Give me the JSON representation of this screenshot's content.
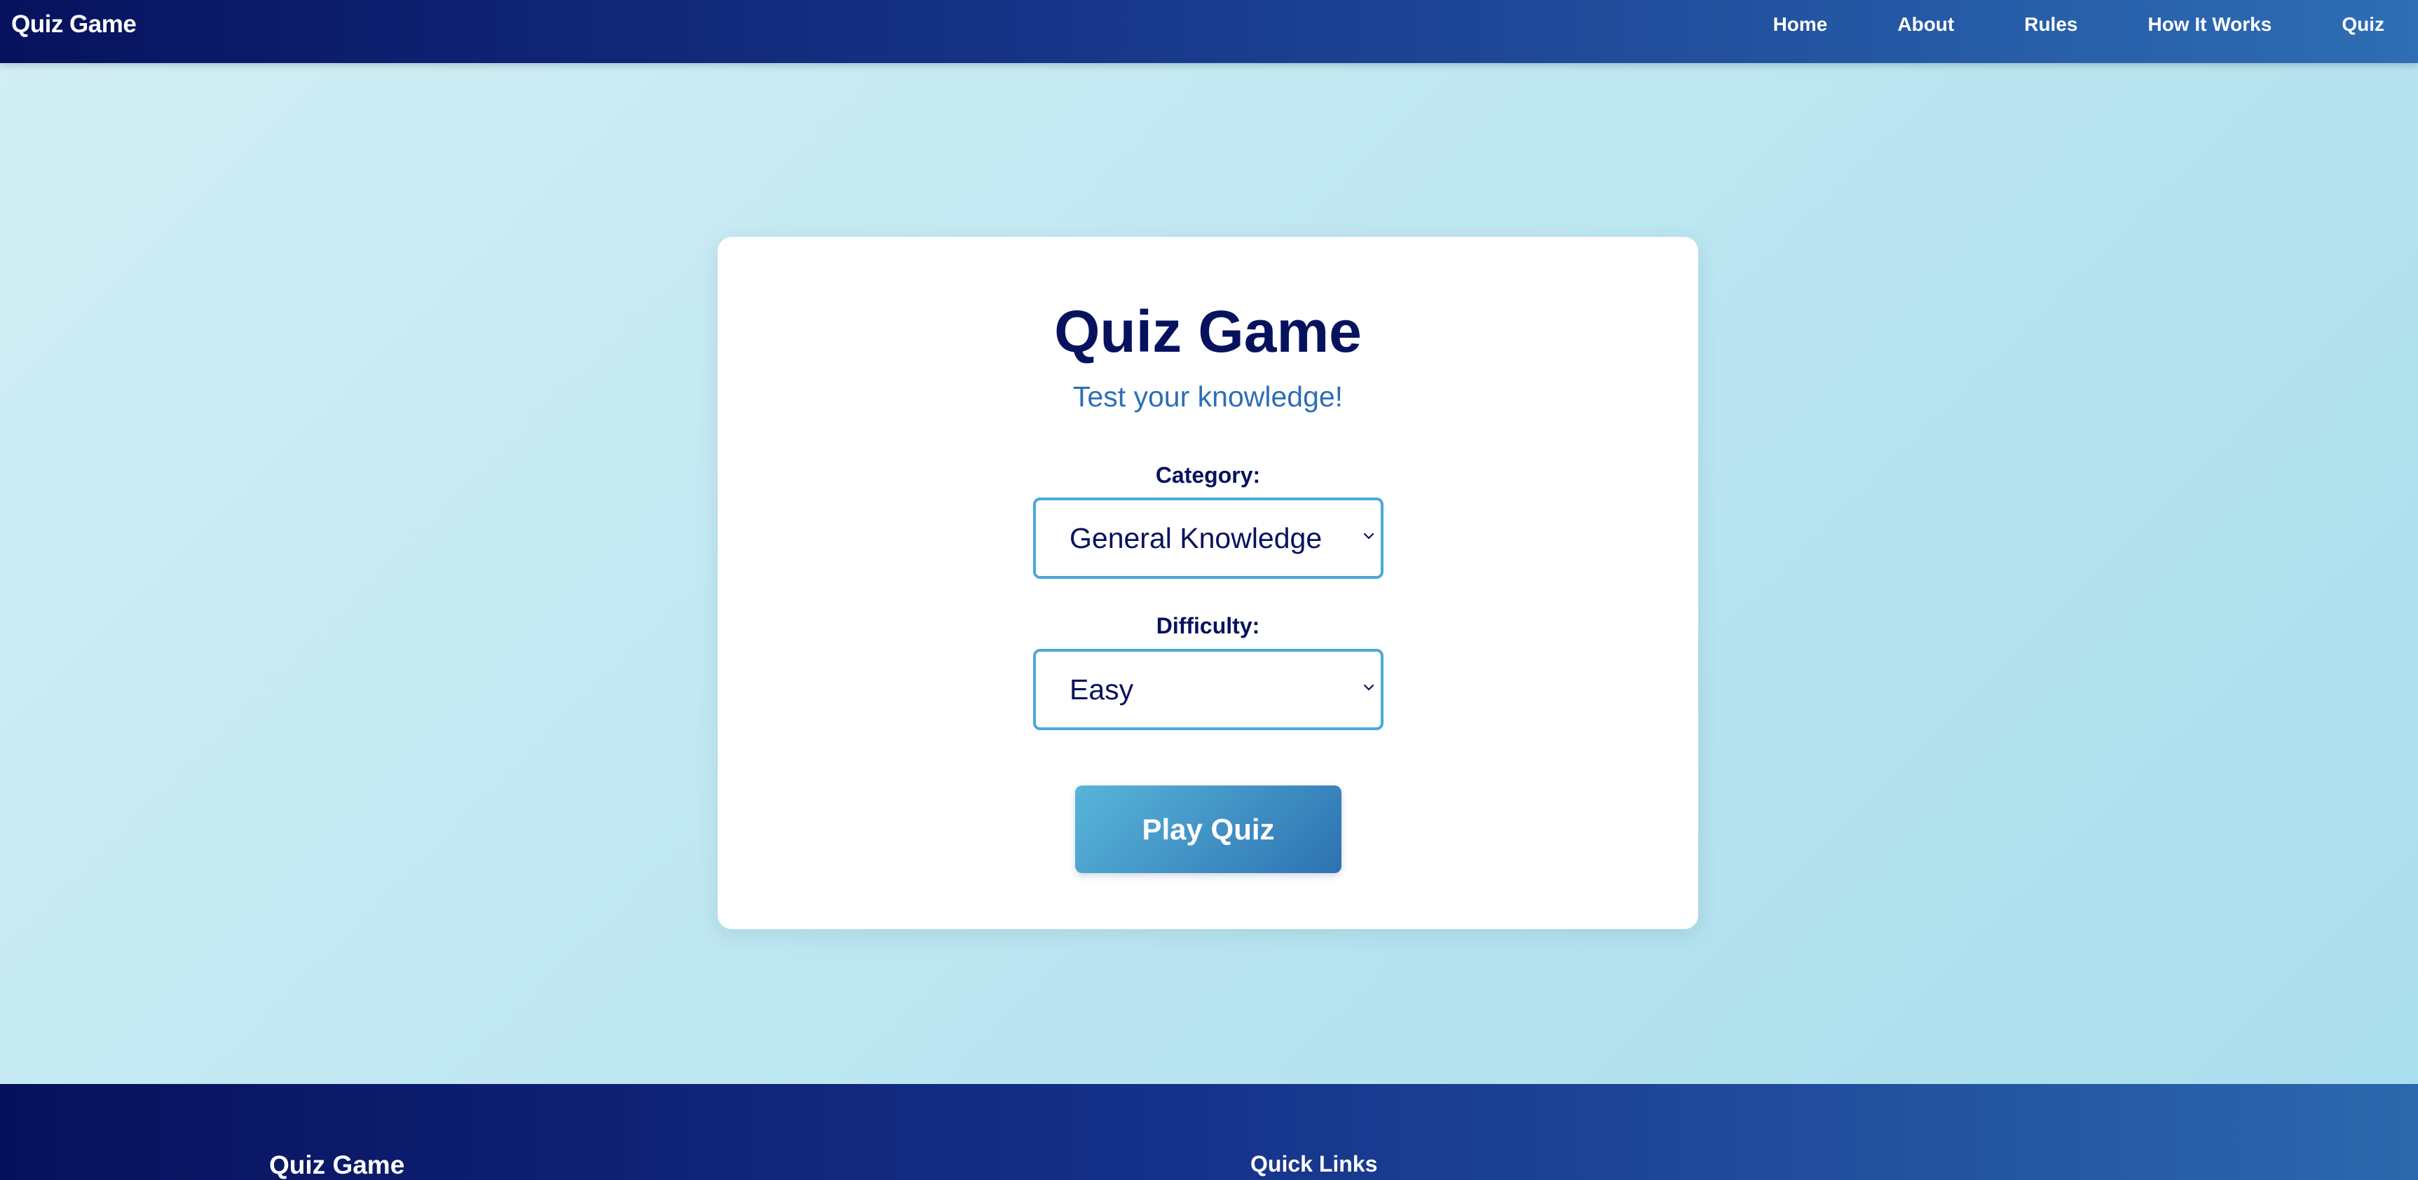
{
  "header": {
    "brand": "Quiz Game",
    "nav": [
      {
        "label": "Home"
      },
      {
        "label": "About"
      },
      {
        "label": "Rules"
      },
      {
        "label": "How It Works"
      },
      {
        "label": "Quiz"
      }
    ]
  },
  "card": {
    "title": "Quiz Game",
    "subtitle": "Test your knowledge!",
    "category": {
      "label": "Category:",
      "selected": "General Knowledge"
    },
    "difficulty": {
      "label": "Difficulty:",
      "selected": "Easy"
    },
    "play_label": "Play Quiz"
  },
  "footer": {
    "brand": "Quiz Game",
    "quick_links_title": "Quick Links"
  },
  "icons": {
    "select_arrow": "chevron-down-icon"
  },
  "colors": {
    "primary_navy": "#07125e",
    "accent_blue": "#2e6eb5",
    "select_border": "#4ba8d8",
    "button_start": "#58b5da",
    "button_end": "#2d72b2",
    "background": "#bfe7f1"
  }
}
